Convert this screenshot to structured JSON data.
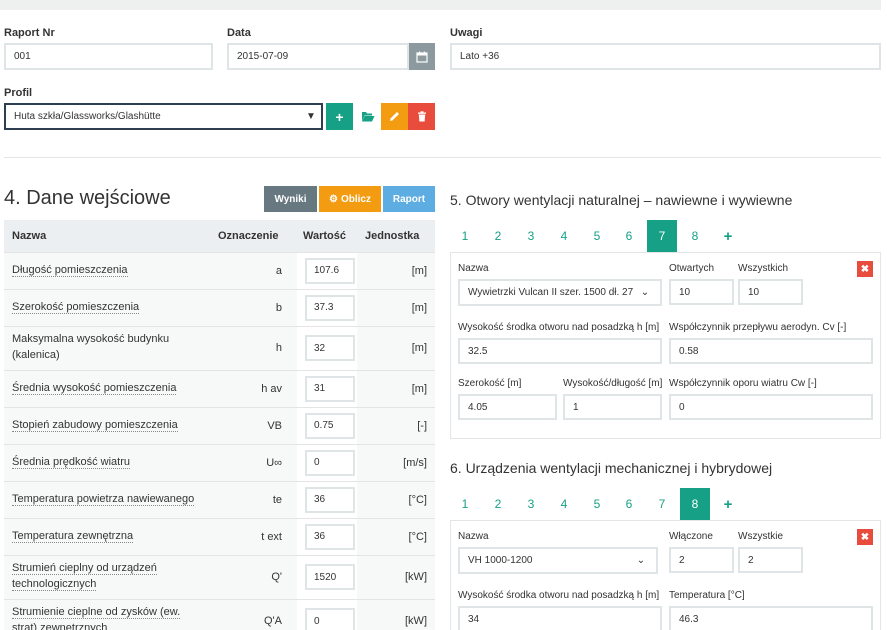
{
  "report": {
    "nr_label": "Raport Nr",
    "nr_value": "001",
    "date_label": "Data",
    "date_value": "2015-07-09",
    "notes_label": "Uwagi",
    "notes_value": "Lato +36",
    "profile_label": "Profil",
    "profile_value": "Huta szkła/Glassworks/Glashütte"
  },
  "input_section": {
    "title": "4. Dane wejściowe",
    "buttons": {
      "results": "Wyniki",
      "calc": "Oblicz",
      "report": "Raport"
    },
    "headers": {
      "name": "Nazwa",
      "symbol": "Oznaczenie",
      "value": "Wartość",
      "unit": "Jednostka"
    },
    "rows": [
      {
        "name": "Długość pomieszczenia",
        "symbol": "a",
        "value": "107.6",
        "unit": "[m]"
      },
      {
        "name": "Szerokość pomieszczenia",
        "symbol": "b",
        "value": "37.3",
        "unit": "[m]"
      },
      {
        "name": "Maksymalna wysokość budynku (kalenica)",
        "symbol": "h",
        "value": "32",
        "unit": "[m]"
      },
      {
        "name": "Średnia wysokość pomieszczenia",
        "symbol": "h av",
        "value": "31",
        "unit": "[m]"
      },
      {
        "name": "Stopień zabudowy pomieszczenia",
        "symbol": "VB",
        "value": "0.75",
        "unit": "[-]"
      },
      {
        "name": "Średnia prędkość wiatru",
        "symbol": "U∞",
        "value": "0",
        "unit": "[m/s]"
      },
      {
        "name": "Temperatura powietrza nawiewanego",
        "symbol": "te",
        "value": "36",
        "unit": "[°C]"
      },
      {
        "name": "Temperatura zewnętrzna",
        "symbol": "t ext",
        "value": "36",
        "unit": "[°C]"
      },
      {
        "name": "Strumień cieplny od urządzeń technologicznych",
        "symbol": "Q'",
        "value": "1520",
        "unit": "[kW]"
      },
      {
        "name": "Strumienie cieplne od zysków (ew. strat) zewnętrznych",
        "symbol": "Q'A",
        "value": "0",
        "unit": "[kW]"
      }
    ]
  },
  "openings": {
    "title": "5. Otwory wentylacji naturalnej – nawiewne i wywiewne",
    "tabs": [
      "1",
      "2",
      "3",
      "4",
      "5",
      "6",
      "7",
      "8"
    ],
    "active_tab": "7",
    "add": "+",
    "name_label": "Nazwa",
    "name_value": "Wywietrzki Vulcan II szer. 1500 dł. 27",
    "open_label": "Otwartych",
    "open_value": "10",
    "all_label": "Wszystkich",
    "all_value": "10",
    "height_label": "Wysokość środka otworu nad posadzką h [m]",
    "height_value": "32.5",
    "cv_label": "Współczynnik przepływu aerodyn. Cv [-]",
    "cv_value": "0.58",
    "width_label": "Szerokość [m]",
    "width_value": "4.05",
    "len_label": "Wysokość/długość [m]",
    "len_value": "1",
    "cw_label": "Współczynnik oporu wiatru Cw [-]",
    "cw_value": "0",
    "remove": "✖"
  },
  "devices": {
    "title": "6. Urządzenia wentylacji mechanicznej i hybrydowej",
    "tabs": [
      "1",
      "2",
      "3",
      "4",
      "5",
      "6",
      "7",
      "8"
    ],
    "active_tab": "8",
    "add": "+",
    "name_label": "Nazwa",
    "name_value": "VH 1000-1200",
    "on_label": "Włączone",
    "on_value": "2",
    "all_label": "Wszystkie",
    "all_value": "2",
    "height_label": "Wysokość środka otworu nad posadzką h [m]",
    "height_value": "34",
    "temp_label": "Temperatura [°C]",
    "temp_value": "46.3",
    "remove": "✖"
  },
  "colors": {
    "teal": "#16a085",
    "orange": "#f39c12",
    "red": "#e74c3c",
    "gray": "#687880",
    "blue": "#5dade2"
  }
}
